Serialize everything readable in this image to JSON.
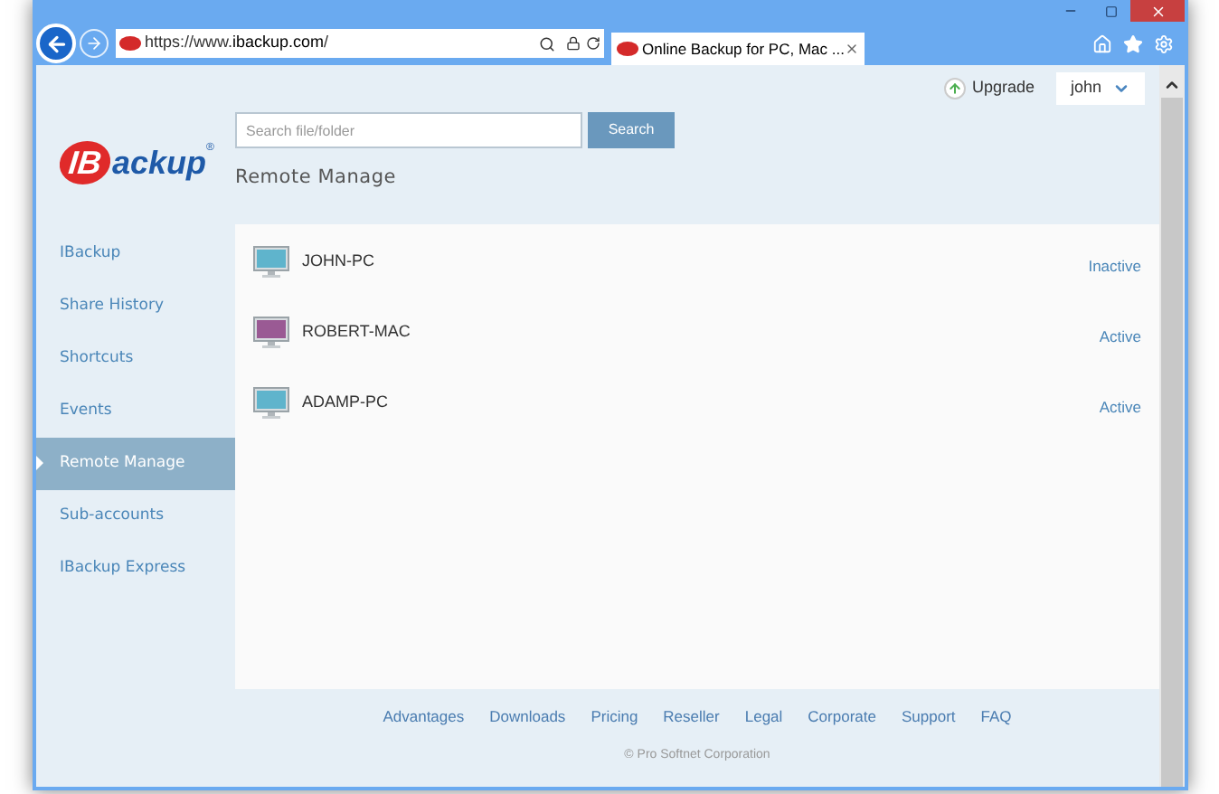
{
  "browser": {
    "url_prefix": "https://www.",
    "url_domain": "ibackup.com",
    "url_suffix": "/",
    "tab_title": "Online Backup for PC, Mac ..."
  },
  "header": {
    "upgrade": "Upgrade",
    "user": "john"
  },
  "logo": {
    "prefix": "IB",
    "suffix": "ackup",
    "mark": "®"
  },
  "search": {
    "placeholder": "Search file/folder",
    "button": "Search"
  },
  "page_title": "Remote Manage",
  "sidebar": {
    "items": [
      {
        "label": "IBackup",
        "selected": false
      },
      {
        "label": "Share History",
        "selected": false
      },
      {
        "label": "Shortcuts",
        "selected": false
      },
      {
        "label": "Events",
        "selected": false
      },
      {
        "label": "Remote Manage",
        "selected": true
      },
      {
        "label": "Sub-accounts",
        "selected": false
      },
      {
        "label": "IBackup Express",
        "selected": false
      }
    ]
  },
  "devices": [
    {
      "name": "JOHN-PC",
      "status": "Inactive",
      "color": "#5fb4cc"
    },
    {
      "name": "ROBERT-MAC",
      "status": "Active",
      "color": "#9a5a94"
    },
    {
      "name": "ADAMP-PC",
      "status": "Active",
      "color": "#5fb4cc"
    }
  ],
  "footer": {
    "links": [
      "Advantages",
      "Downloads",
      "Pricing",
      "Reseller",
      "Legal",
      "Corporate",
      "Support",
      "FAQ"
    ],
    "copyright": "© Pro Softnet Corporation"
  }
}
